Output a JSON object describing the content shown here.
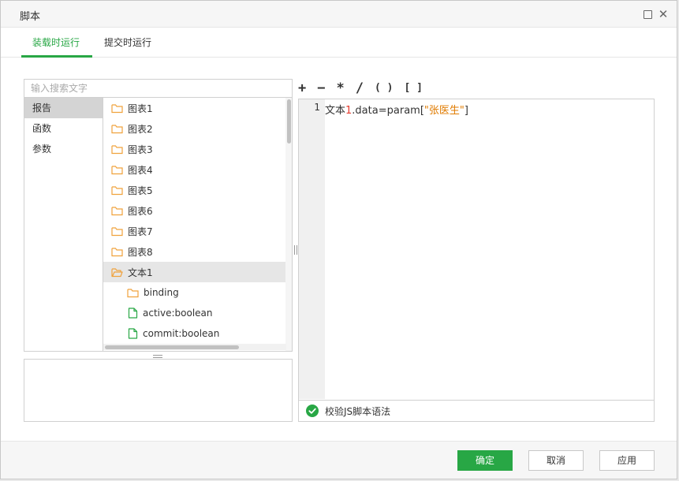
{
  "window": {
    "title": "脚本"
  },
  "tabs": [
    {
      "label": "装载时运行",
      "active": true
    },
    {
      "label": "提交时运行",
      "active": false
    }
  ],
  "search": {
    "placeholder": "输入搜索文字"
  },
  "categories": [
    {
      "label": "报告",
      "active": true
    },
    {
      "label": "函数",
      "active": false
    },
    {
      "label": "参数",
      "active": false
    }
  ],
  "tree": [
    {
      "label": "图表1",
      "icon": "folder-icon"
    },
    {
      "label": "图表2",
      "icon": "folder-icon"
    },
    {
      "label": "图表3",
      "icon": "folder-icon"
    },
    {
      "label": "图表4",
      "icon": "folder-icon"
    },
    {
      "label": "图表5",
      "icon": "folder-icon"
    },
    {
      "label": "图表6",
      "icon": "folder-icon"
    },
    {
      "label": "图表7",
      "icon": "folder-icon"
    },
    {
      "label": "图表8",
      "icon": "folder-icon"
    },
    {
      "label": "文本1",
      "icon": "folder-open-icon",
      "selected": true
    },
    {
      "label": "binding",
      "icon": "folder-icon"
    },
    {
      "label": "active:boolean",
      "icon": "file-icon"
    },
    {
      "label": "commit:boolean",
      "icon": "file-icon"
    }
  ],
  "operators": [
    "+",
    "−",
    "*",
    "/",
    "( )",
    "[ ]"
  ],
  "editor": {
    "line_number": "1",
    "code": {
      "prefix": "文本",
      "num": "1",
      "mid": ".data",
      "eq": "=",
      "fn": "param[",
      "str": "\"张医生\"",
      "end": "]"
    },
    "validate_label": "校验JS脚本语法"
  },
  "footer": {
    "ok": "确定",
    "cancel": "取消",
    "apply": "应用"
  },
  "colors": {
    "accent": "#28a745",
    "folder": "#f0a23c",
    "file": "#28a745"
  }
}
